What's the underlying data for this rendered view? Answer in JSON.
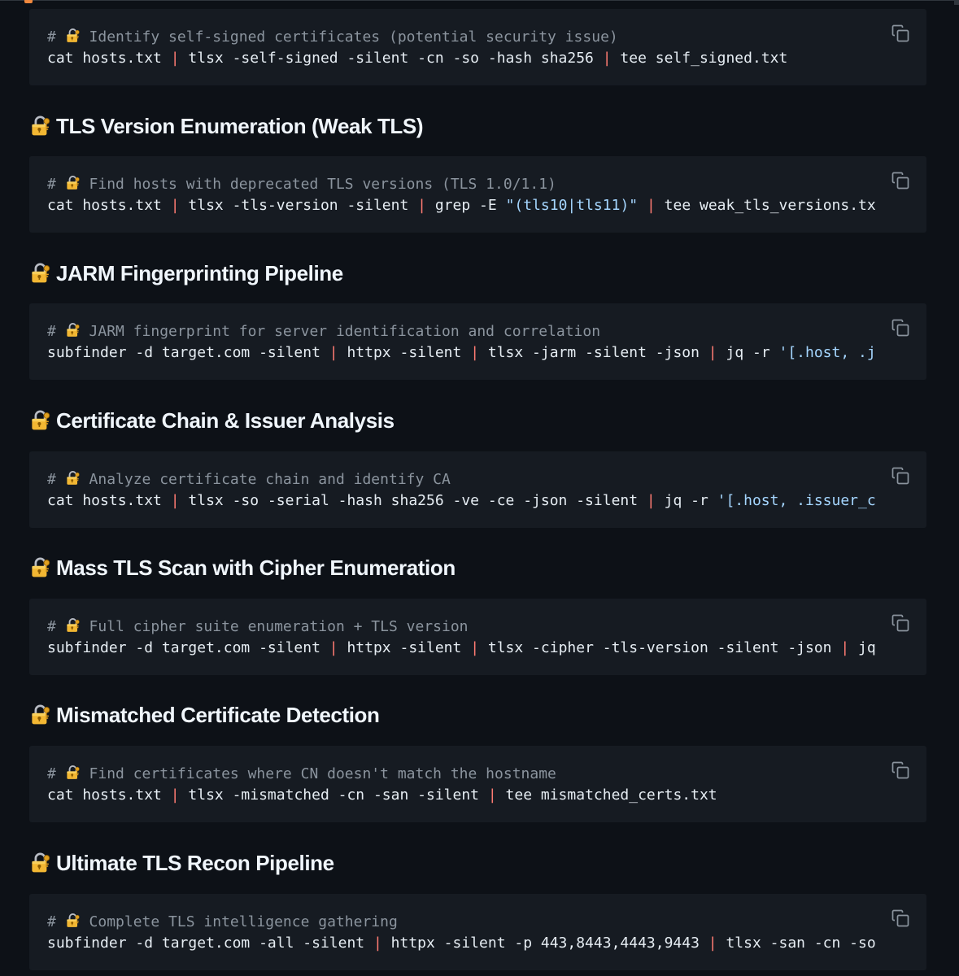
{
  "sections": [
    {
      "heading": "",
      "comment_icon": "locked-with-key-icon",
      "comment_prefix": "# ",
      "comment_text": "Identify self-signed certificates (potential security issue)",
      "tokens": [
        {
          "t": "cat hosts.txt ",
          "k": "cmd"
        },
        {
          "t": "|",
          "k": "pipe"
        },
        {
          "t": " tlsx -self-signed -silent -cn -so -hash sha256 ",
          "k": "cmd"
        },
        {
          "t": "|",
          "k": "pipe"
        },
        {
          "t": " tee self_signed.txt",
          "k": "cmd"
        }
      ]
    },
    {
      "heading": "TLS Version Enumeration (Weak TLS)",
      "comment_icon": "locked-with-key-icon",
      "comment_prefix": "# ",
      "comment_text": "Find hosts with deprecated TLS versions (TLS 1.0/1.1)",
      "tokens": [
        {
          "t": "cat hosts.txt ",
          "k": "cmd"
        },
        {
          "t": "|",
          "k": "pipe"
        },
        {
          "t": " tlsx -tls-version -silent ",
          "k": "cmd"
        },
        {
          "t": "|",
          "k": "pipe"
        },
        {
          "t": " grep -E ",
          "k": "cmd"
        },
        {
          "t": "\"(tls10|tls11)\"",
          "k": "str"
        },
        {
          "t": " ",
          "k": "cmd"
        },
        {
          "t": "|",
          "k": "pipe"
        },
        {
          "t": " tee weak_tls_versions.tx",
          "k": "cmd"
        }
      ]
    },
    {
      "heading": "JARM Fingerprinting Pipeline",
      "comment_icon": "locked-with-key-icon",
      "comment_prefix": "# ",
      "comment_text": "JARM fingerprint for server identification and correlation",
      "tokens": [
        {
          "t": "subfinder -d target.com -silent ",
          "k": "cmd"
        },
        {
          "t": "|",
          "k": "pipe"
        },
        {
          "t": " httpx -silent ",
          "k": "cmd"
        },
        {
          "t": "|",
          "k": "pipe"
        },
        {
          "t": " tlsx -jarm -silent -json ",
          "k": "cmd"
        },
        {
          "t": "|",
          "k": "pipe"
        },
        {
          "t": " jq -r ",
          "k": "cmd"
        },
        {
          "t": "'[.host, .j",
          "k": "str"
        }
      ]
    },
    {
      "heading": "Certificate Chain & Issuer Analysis",
      "comment_icon": "locked-with-key-icon",
      "comment_prefix": "# ",
      "comment_text": "Analyze certificate chain and identify CA",
      "tokens": [
        {
          "t": "cat hosts.txt ",
          "k": "cmd"
        },
        {
          "t": "|",
          "k": "pipe"
        },
        {
          "t": " tlsx -so -serial -hash sha256 -ve -ce -json -silent ",
          "k": "cmd"
        },
        {
          "t": "|",
          "k": "pipe"
        },
        {
          "t": " jq -r ",
          "k": "cmd"
        },
        {
          "t": "'[.host, .issuer_c",
          "k": "str"
        }
      ]
    },
    {
      "heading": "Mass TLS Scan with Cipher Enumeration",
      "comment_icon": "locked-with-key-icon",
      "comment_prefix": "# ",
      "comment_text": "Full cipher suite enumeration + TLS version",
      "tokens": [
        {
          "t": "subfinder -d target.com -silent ",
          "k": "cmd"
        },
        {
          "t": "|",
          "k": "pipe"
        },
        {
          "t": " httpx -silent ",
          "k": "cmd"
        },
        {
          "t": "|",
          "k": "pipe"
        },
        {
          "t": " tlsx -cipher -tls-version -silent -json ",
          "k": "cmd"
        },
        {
          "t": "|",
          "k": "pipe"
        },
        {
          "t": " jq",
          "k": "cmd"
        }
      ]
    },
    {
      "heading": "Mismatched Certificate Detection",
      "comment_icon": "locked-with-key-icon",
      "comment_prefix": "# ",
      "comment_text": "Find certificates where CN doesn't match the hostname",
      "tokens": [
        {
          "t": "cat hosts.txt ",
          "k": "cmd"
        },
        {
          "t": "|",
          "k": "pipe"
        },
        {
          "t": " tlsx -mismatched -cn -san -silent ",
          "k": "cmd"
        },
        {
          "t": "|",
          "k": "pipe"
        },
        {
          "t": " tee mismatched_certs.txt",
          "k": "cmd"
        }
      ]
    },
    {
      "heading": "Ultimate TLS Recon Pipeline",
      "comment_icon": "locked-with-key-icon",
      "comment_prefix": "# ",
      "comment_text": "Complete TLS intelligence gathering",
      "tokens": [
        {
          "t": "subfinder -d target.com -all -silent ",
          "k": "cmd"
        },
        {
          "t": "|",
          "k": "pipe"
        },
        {
          "t": " httpx -silent -p 443,8443,4443,9443 ",
          "k": "cmd"
        },
        {
          "t": "|",
          "k": "pipe"
        },
        {
          "t": " tlsx -san -cn -so",
          "k": "cmd"
        }
      ]
    }
  ],
  "heading_icon": "locked-with-key-icon",
  "copy_icon": "copy-icon",
  "colors": {
    "background": "#0d1117",
    "code_background": "#161b22",
    "heading": "#f0f6fc",
    "comment": "#8b949e",
    "command": "#e6edf3",
    "pipe": "#ff7b72",
    "string": "#a5d6ff",
    "copy_icon": "#8b949e"
  }
}
